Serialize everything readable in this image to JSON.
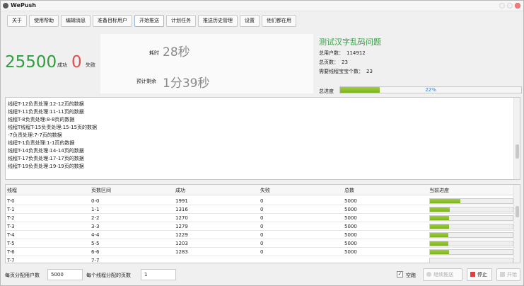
{
  "window": {
    "title": "WePush"
  },
  "tabs": [
    "关于",
    "使用帮助",
    "编辑消息",
    "准备目标用户",
    "开始推送",
    "计划任务",
    "推送历史管理",
    "设置",
    "他们都在用"
  ],
  "active_tab": 4,
  "stats": {
    "success_count": "25500",
    "success_label": "成功",
    "fail_count": "0",
    "fail_label": "失败",
    "elapsed_label": "耗时",
    "elapsed_value": "28秒",
    "remaining_label": "预计剩余",
    "remaining_value": "1分39秒",
    "headline": "测试汉字乱码问题",
    "total_users_label": "总用户数：",
    "total_users": "114912",
    "total_pages_label": "总页数：",
    "total_pages": "23",
    "threads_label": "需要线程宝宝个数：",
    "threads": "23",
    "progress_label": "总进度",
    "progress_text": "22%",
    "progress_percent": 22
  },
  "log_lines": [
    "线程T-12负责处理:12-12页的数据",
    "线程T-11负责处理:11-11页的数据",
    "线程T-8负责处理:8-8页的数据",
    "线程T线程T-15负责处理:15-15页的数据",
    "-7负责处理:7-7页的数据",
    "线程T-1负责处理:1-1页的数据",
    "线程T-14负责处理:14-14页的数据",
    "线程T-17负责处理:17-17页的数据",
    "线程T-19负责处理:19-19页的数据"
  ],
  "table": {
    "headers": [
      "线程",
      "页数区间",
      "成功",
      "失败",
      "总数",
      "当前进度"
    ],
    "rows": [
      {
        "thread": "T-0",
        "range": "0-0",
        "success": "1991",
        "fail": "0",
        "total": "5000",
        "progress": 0.37
      },
      {
        "thread": "T-1",
        "range": "1-1",
        "success": "1316",
        "fail": "0",
        "total": "5000",
        "progress": 0.24
      },
      {
        "thread": "T-2",
        "range": "2-2",
        "success": "1270",
        "fail": "0",
        "total": "5000",
        "progress": 0.23
      },
      {
        "thread": "T-3",
        "range": "3-3",
        "success": "1279",
        "fail": "0",
        "total": "5000",
        "progress": 0.23
      },
      {
        "thread": "T-4",
        "range": "4-4",
        "success": "1229",
        "fail": "0",
        "total": "5000",
        "progress": 0.22
      },
      {
        "thread": "T-5",
        "range": "5-5",
        "success": "1203",
        "fail": "0",
        "total": "5000",
        "progress": 0.22
      },
      {
        "thread": "T-6",
        "range": "6-6",
        "success": "1283",
        "fail": "0",
        "total": "5000",
        "progress": 0.23
      },
      {
        "thread": "T-7",
        "range": "7-7",
        "success": "",
        "fail": "",
        "total": "",
        "progress": 0
      }
    ]
  },
  "bottom": {
    "users_per_page_label": "每页分配用户数",
    "users_per_page_value": "5000",
    "pages_per_thread_label": "每个线程分配的页数",
    "pages_per_thread_value": "1",
    "dry_run_label": "空跑",
    "dry_run_checked": "✓",
    "resume_button": "继续推送",
    "stop_button": "停止",
    "start_button": "开始"
  },
  "colors": {
    "accent_green": "#2e9e3e",
    "fail_red": "#e05050",
    "progress_green": "#8cc12a",
    "progress_text": "#3a7fc1"
  }
}
